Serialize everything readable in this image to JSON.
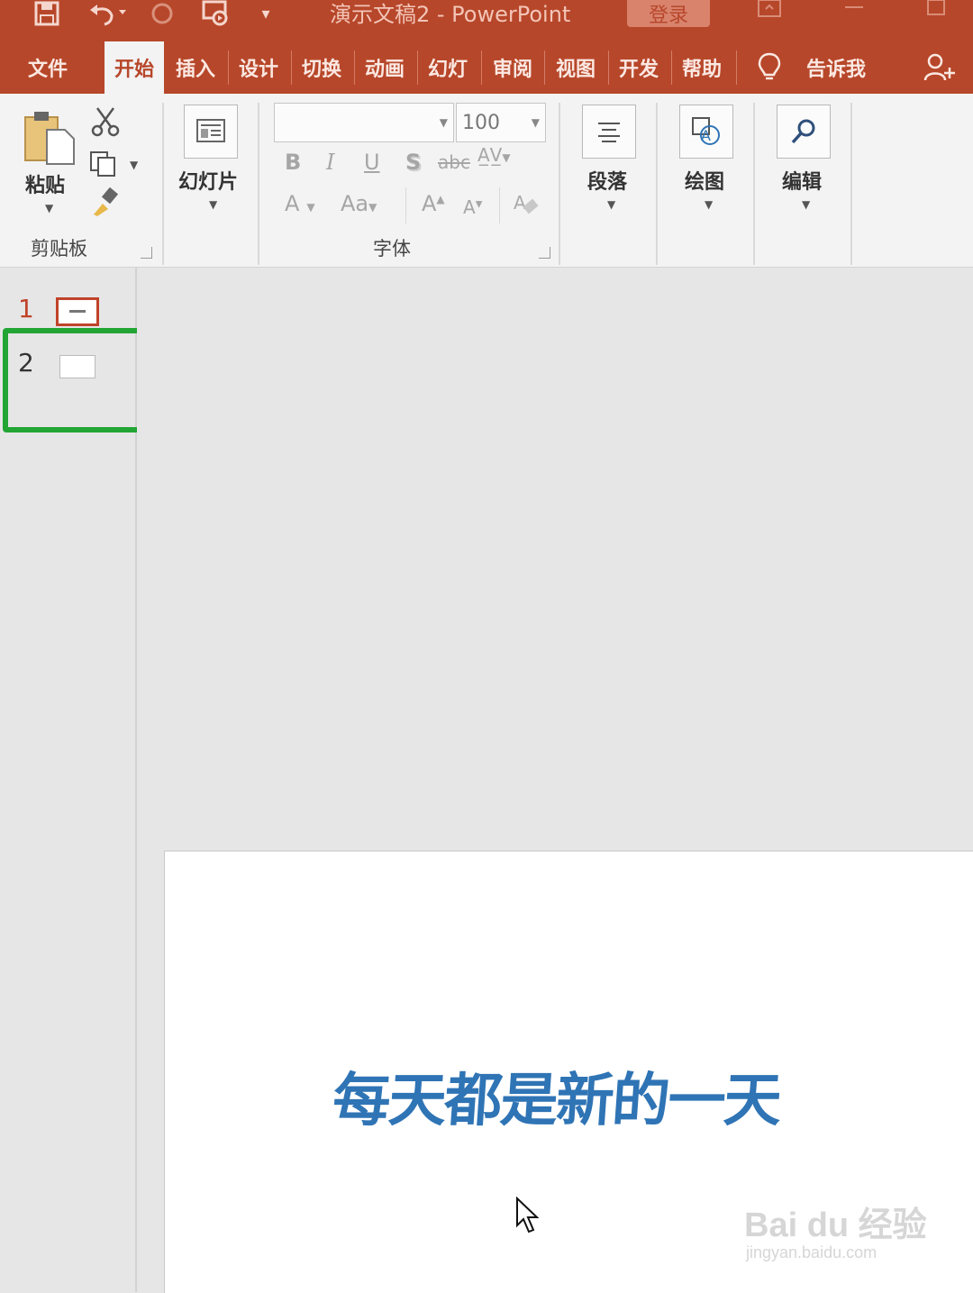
{
  "window": {
    "title": "演示文稿2  -  PowerPoint",
    "login_label": "登录"
  },
  "tabs": [
    {
      "label": "文件"
    },
    {
      "label": "开始",
      "active": true
    },
    {
      "label": "插入"
    },
    {
      "label": "设计"
    },
    {
      "label": "切换"
    },
    {
      "label": "动画"
    },
    {
      "label": "幻灯"
    },
    {
      "label": "审阅"
    },
    {
      "label": "视图"
    },
    {
      "label": "开发"
    },
    {
      "label": "帮助"
    }
  ],
  "tell_me": "告诉我",
  "ribbon": {
    "clipboard": {
      "paste_label": "粘贴",
      "group_label": "剪贴板"
    },
    "slides": {
      "new_slide_label": "幻灯片"
    },
    "font": {
      "font_name": "",
      "font_size": "100",
      "group_label": "字体"
    },
    "paragraph": {
      "label": "段落"
    },
    "drawing": {
      "label": "绘图"
    },
    "editing": {
      "label": "编辑"
    }
  },
  "thumbnails": [
    {
      "number": "1"
    },
    {
      "number": "2"
    }
  ],
  "slide": {
    "title_text": "每天都是新的一天"
  },
  "watermark": {
    "brand": "Bai du 经验",
    "url": "jingyan.baidu.com"
  },
  "colors": {
    "accent": "#b7472a",
    "highlight": "#22a534",
    "slide_text": "#2f74b5"
  }
}
